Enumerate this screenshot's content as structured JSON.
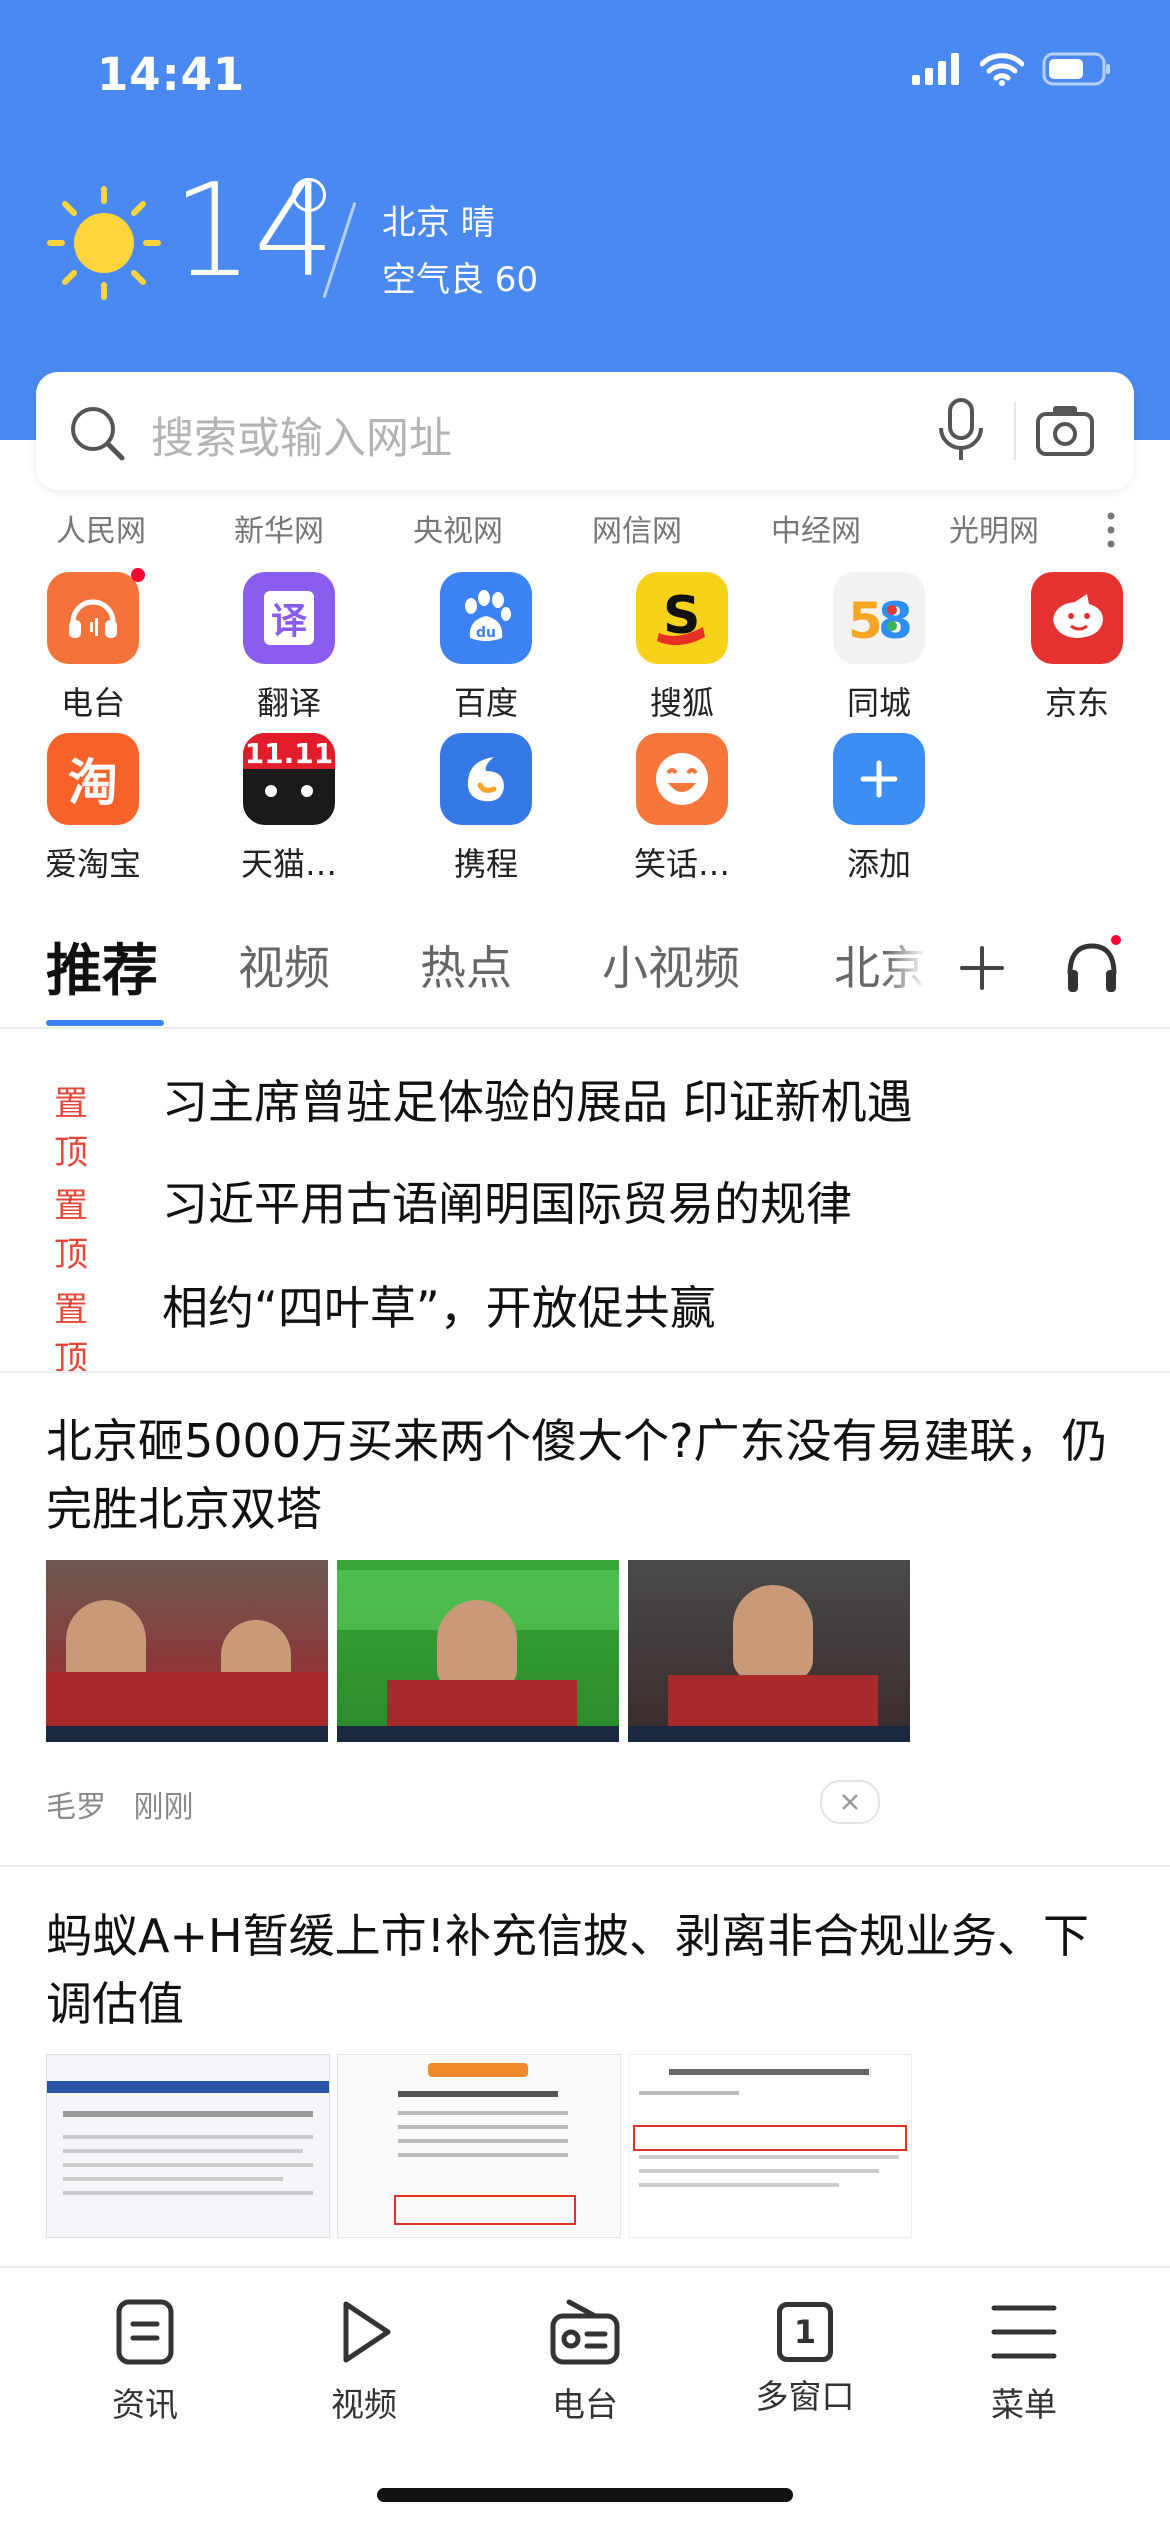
{
  "status_bar": {
    "time": "14:41"
  },
  "weather": {
    "temperature": "14",
    "city_condition": "北京  晴",
    "air_quality": "空气良 60"
  },
  "search": {
    "placeholder": "搜索或输入网址"
  },
  "site_links": [
    "人民网",
    "新华网",
    "央视网",
    "网信网",
    "中经网",
    "光明网"
  ],
  "apps": [
    {
      "label": "电台",
      "icon": "radio-icon",
      "color": "#f4733a"
    },
    {
      "label": "翻译",
      "icon": "translate-icon",
      "color": "#8a5cf0"
    },
    {
      "label": "百度",
      "icon": "baidu-paw-icon",
      "color": "#3d82f2"
    },
    {
      "label": "搜狐",
      "icon": "sohu-icon",
      "color": "#f6d21a"
    },
    {
      "label": "同城",
      "icon": "58-icon",
      "color": "#f3f3f3"
    },
    {
      "label": "京东",
      "icon": "jd-dog-icon",
      "color": "#e3322f"
    },
    {
      "label": "爱淘宝",
      "icon": "taobao-icon",
      "color": "#f7622b"
    },
    {
      "label": "天猫…",
      "icon": "tmall-icon",
      "color": "#1a1a1a"
    },
    {
      "label": "携程",
      "icon": "ctrip-dolphin-icon",
      "color": "#3678e6"
    },
    {
      "label": "笑话…",
      "icon": "joke-face-icon",
      "color": "#f7763a"
    },
    {
      "label": "添加",
      "icon": "plus-icon",
      "color": "#3d8ef3"
    }
  ],
  "tabs": [
    "推荐",
    "视频",
    "热点",
    "小视频",
    "北京"
  ],
  "pinned": {
    "tag": "置顶",
    "items": [
      "习主席曾驻足体验的展品 印证新机遇",
      "习近平用古语阐明国际贸易的规律",
      "相约“四叶草”，开放促共赢"
    ]
  },
  "articles": [
    {
      "title": "北京砸5000万买来两个傻大个?广东没有易建联，仍完胜北京双塔",
      "author": "毛罗",
      "time": "刚刚"
    },
    {
      "title": "蚂蚁A+H暂缓上市!补充信披、剥离非合规业务、下调估值"
    }
  ],
  "bottom_nav": [
    "资讯",
    "视频",
    "电台",
    "多窗口",
    "菜单"
  ],
  "window_count": "1"
}
